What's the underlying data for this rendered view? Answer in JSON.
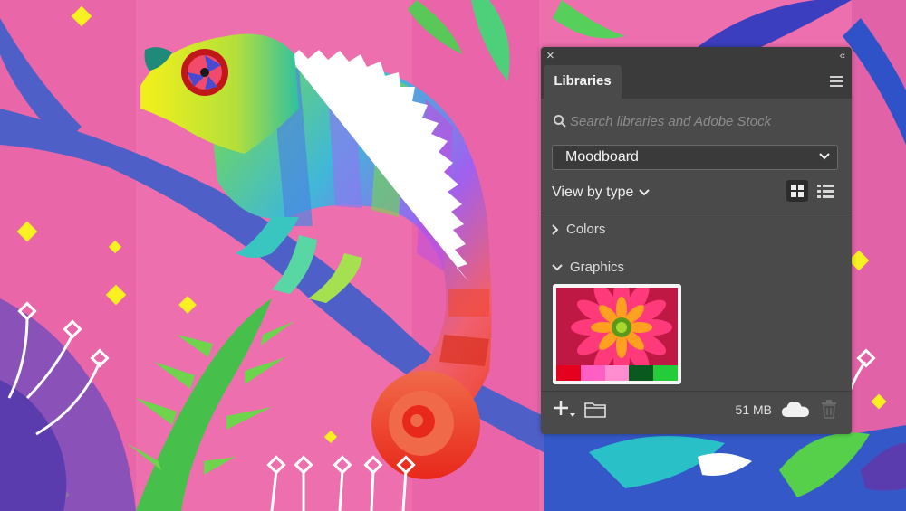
{
  "panel": {
    "tab_label": "Libraries",
    "search_placeholder": "Search libraries and Adobe Stock",
    "library_name": "Moodboard",
    "view_by_label": "View by type",
    "sections": [
      {
        "label": "Colors",
        "state": "collapsed"
      },
      {
        "label": "Graphics",
        "state": "expanded"
      }
    ],
    "graphic_swatches": [
      "#e4001e",
      "#ff5ec3",
      "#ff8dd0",
      "#0a5a1f",
      "#25cc3a"
    ],
    "storage_label": "51 MB",
    "icons": [
      "close-icon",
      "collapse-icon",
      "menu-icon",
      "search-icon",
      "chevron-down-icon",
      "grid-view-icon",
      "list-view-icon",
      "chevron-right-icon",
      "add-icon",
      "folder-icon",
      "cloud-icon",
      "trash-icon"
    ]
  },
  "colors": {
    "background_pink": "#ee6fae",
    "panel_bg": "#4a4a4a",
    "panel_header": "#3b3b3b"
  }
}
